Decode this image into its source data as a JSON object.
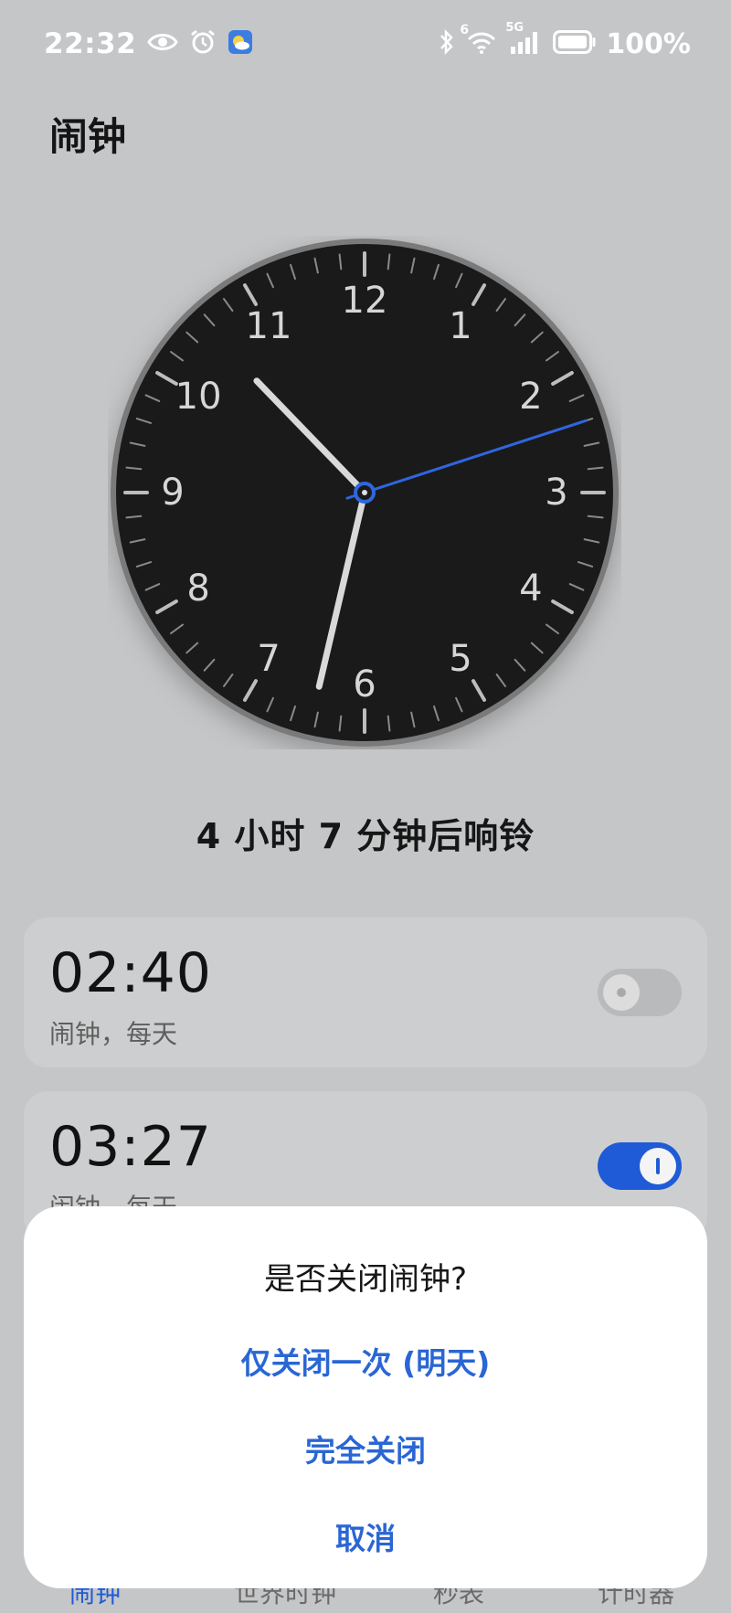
{
  "status_bar": {
    "time": "22:32",
    "battery": "100%",
    "network_label": "5G",
    "wifi_badge": "6"
  },
  "header": {
    "title": "闹钟"
  },
  "clock": {
    "numbers": [
      "12",
      "1",
      "2",
      "3",
      "4",
      "5",
      "6",
      "7",
      "8",
      "9",
      "10",
      "11"
    ],
    "display_time": {
      "hour": 10,
      "minute": 32,
      "second": 12
    },
    "face_color": "#1a1a1a",
    "second_hand_color": "#2f66e0"
  },
  "ring_text": "4 小时 7 分钟后响铃",
  "alarms": [
    {
      "time": "02:40",
      "sub": "闹钟，每天",
      "enabled": false
    },
    {
      "time": "03:27",
      "sub": "闹钟，每天",
      "enabled": true
    }
  ],
  "bottom_nav": [
    {
      "label": "闹钟",
      "active": true
    },
    {
      "label": "世界时钟",
      "active": false
    },
    {
      "label": "秒表",
      "active": false
    },
    {
      "label": "计时器",
      "active": false
    }
  ],
  "dialog": {
    "title": "是否关闭闹钟?",
    "options": [
      "仅关闭一次 (明天)",
      "完全关闭",
      "取消"
    ]
  },
  "colors": {
    "accent": "#1f5bd6",
    "background": "#c4c6c8",
    "card": "#cdcecf",
    "sheet": "#ffffff"
  }
}
